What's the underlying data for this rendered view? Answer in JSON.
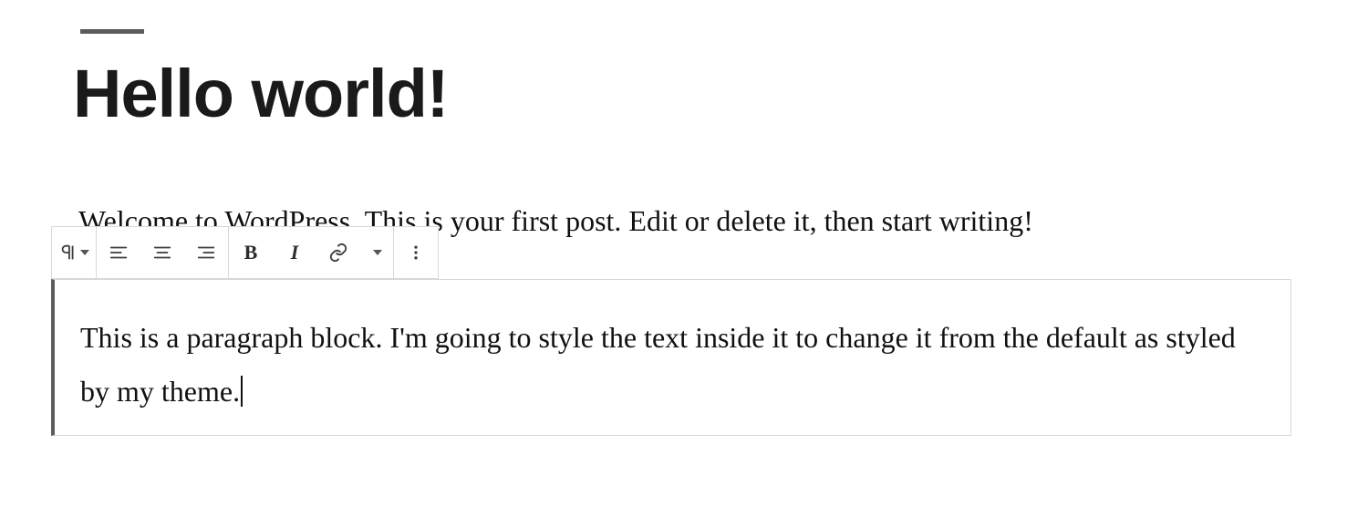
{
  "post": {
    "title": "Hello world!",
    "intro_paragraph": "Welcome to WordPress. This is your first post. Edit or delete it, then start writing!",
    "active_block_text": "This is a paragraph block. I'm going to style the text inside it to change it from the default as styled by my theme."
  },
  "toolbar": {
    "block_type_icon": "pilcrow-icon",
    "align_left_icon": "align-left-icon",
    "align_center_icon": "align-center-icon",
    "align_right_icon": "align-right-icon",
    "bold_label": "B",
    "italic_label": "I",
    "link_icon": "link-icon",
    "more_rich_icon": "chevron-down-icon",
    "more_options_icon": "more-vertical-icon"
  }
}
